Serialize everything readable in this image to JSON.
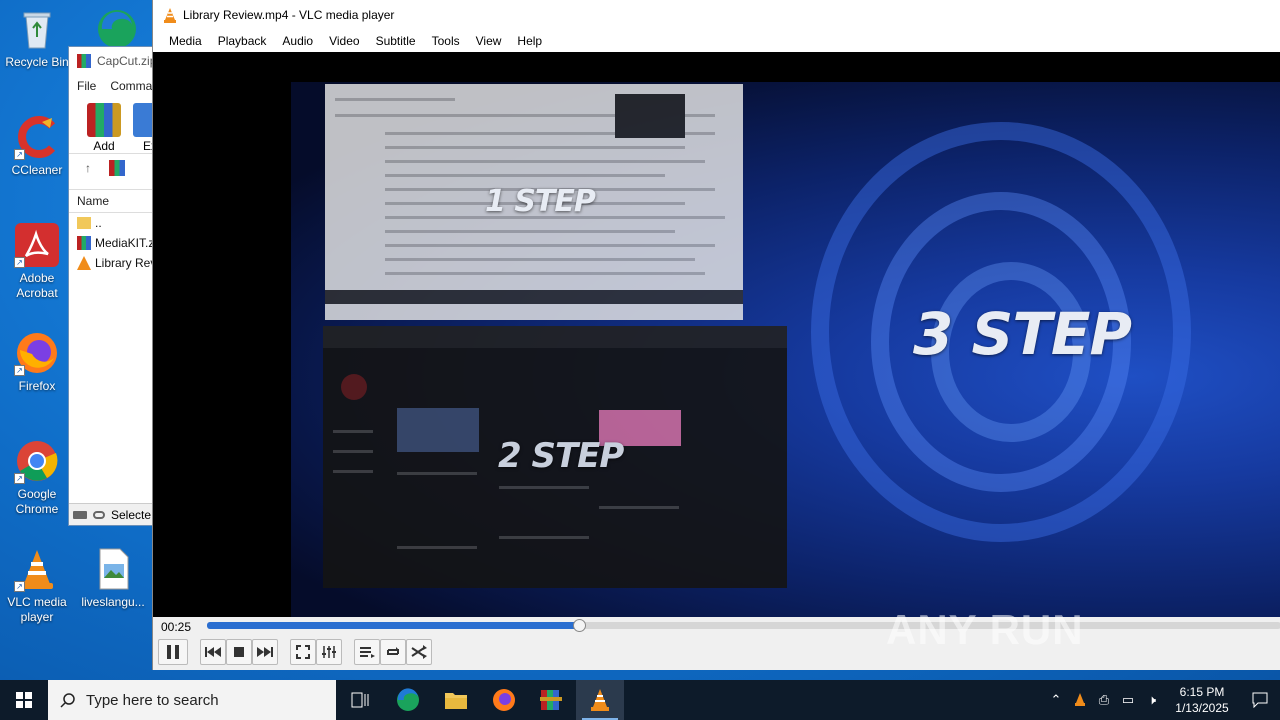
{
  "desktop": {
    "icons": [
      {
        "label": "Recycle Bin",
        "icon": "recycle-bin-icon"
      },
      {
        "label": "CCleaner",
        "icon": "ccleaner-icon"
      },
      {
        "label": "Adobe Acrobat",
        "icon": "acrobat-icon"
      },
      {
        "label": "Firefox",
        "icon": "firefox-icon"
      },
      {
        "label": "Google Chrome",
        "icon": "chrome-icon"
      },
      {
        "label": "VLC media player",
        "icon": "vlc-icon"
      },
      {
        "label": "liveslangu...",
        "icon": "image-file-icon"
      }
    ]
  },
  "bg_window": {
    "title": "CapCut.zip",
    "menu": [
      "File",
      "Comma"
    ],
    "tools": [
      "Add",
      "Ex"
    ],
    "column_header": "Name",
    "rows": [
      "..",
      "MediaKIT.zi",
      "Library Revi"
    ],
    "status": "Selecte"
  },
  "vlc": {
    "title": "Library Review.mp4 - VLC media player",
    "menu": [
      "Media",
      "Playback",
      "Audio",
      "Video",
      "Subtitle",
      "Tools",
      "View",
      "Help"
    ],
    "video_text": {
      "step1": "1 STEP",
      "step2": "2 STEP",
      "step3": "3 STEP"
    },
    "elapsed": "00:25",
    "progress_fraction": 0.346
  },
  "watermark": "ANY RUN",
  "taskbar": {
    "search_placeholder": "Type here to search",
    "time": "6:15 PM",
    "date": "1/13/2025"
  },
  "colors": {
    "accent": "#2a6ed0",
    "taskbar": "#0d1b2a",
    "desktop": "#1a7fd8"
  }
}
